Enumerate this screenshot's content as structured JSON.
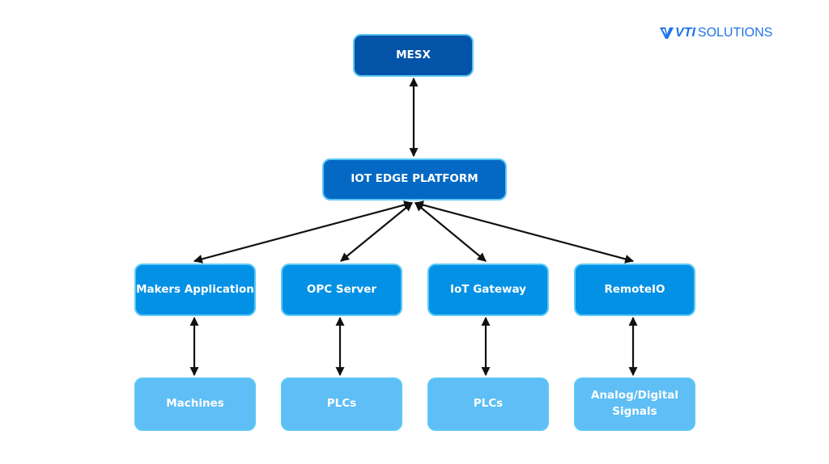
{
  "logo": {
    "text_bold": "VTI",
    "text_light": "SOLUTIONS",
    "color": "#1e73e8"
  },
  "nodes": {
    "mesx": "MESX",
    "edge": "IOT EDGE PLATFORM",
    "makers": "Makers Application",
    "opc": "OPC Server",
    "iot_gateway": "IoT Gateway",
    "remoteio": "RemoteIO",
    "machines": "Machines",
    "plcs_1": "PLCs",
    "plcs_2": "PLCs",
    "signals": "Analog/Digital Signals"
  },
  "colors": {
    "level0": "#0353a8",
    "level1": "#0369c4",
    "level2": "#0391e6",
    "level3": "#5ebef5",
    "border": "#5cc8f5",
    "arrow": "#111111"
  },
  "edges": [
    [
      "mesx",
      "edge"
    ],
    [
      "edge",
      "makers"
    ],
    [
      "edge",
      "opc"
    ],
    [
      "edge",
      "iot_gateway"
    ],
    [
      "edge",
      "remoteio"
    ],
    [
      "makers",
      "machines"
    ],
    [
      "opc",
      "plcs_1"
    ],
    [
      "iot_gateway",
      "plcs_2"
    ],
    [
      "remoteio",
      "signals"
    ]
  ]
}
